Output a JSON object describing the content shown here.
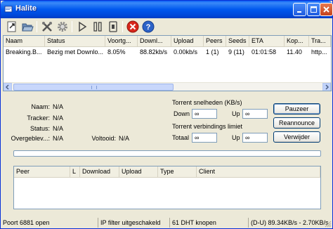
{
  "window": {
    "title": "Halite"
  },
  "toolbar": {
    "icons": [
      "open-torrent-icon",
      "open-folder-icon",
      "tools-icon",
      "settings-gear-icon",
      "resume-icon",
      "pause-icon",
      "stop-icon",
      "remove-icon",
      "help-icon"
    ]
  },
  "torrent_list": {
    "columns": [
      "Naam",
      "Status",
      "Voortg...",
      "Downl...",
      "Upload",
      "Peers",
      "Seeds",
      "ETA",
      "Kop...",
      "Tra..."
    ],
    "rows": [
      {
        "naam": "Breaking.B...",
        "status": "Bezig met Downlo...",
        "voortgang": "8.05%",
        "download": "88.82kb/s",
        "upload": "0.00kb/s",
        "peers": "1 (1)",
        "seeds": "9 (11)",
        "eta": "01:01:58",
        "kop": "11.40",
        "tra": "http..."
      }
    ]
  },
  "details": {
    "naam_label": "Naam:",
    "naam_value": "N/A",
    "tracker_label": "Tracker:",
    "tracker_value": "N/A",
    "status_label": "Status:",
    "status_value": "N/A",
    "overgeblev_label": "Overgeblev...:",
    "overgeblev_value": "N/A",
    "voltooid_label": "Voltooid:",
    "voltooid_value": "N/A",
    "speed_heading": "Torrent snelheden (KB/s)",
    "down_label": "Down",
    "down_value": "∞",
    "up_label": "Up",
    "up_value": "∞",
    "conn_heading": "Torrent verbindings limiet",
    "totaal_label": "Totaal",
    "totaal_value": "∞",
    "up2_label": "Up",
    "up2_value": "∞",
    "pause_button": "Pauzeer",
    "reannounce_button": "Reannounce",
    "remove_button": "Verwijder",
    "progress": 0
  },
  "peer_list": {
    "columns": [
      "Peer",
      "L",
      "Download",
      "Upload",
      "Type",
      "Client"
    ]
  },
  "statusbar": {
    "port": "Poort 6881 open",
    "ipfilter": "IP filter uitgeschakeld",
    "dht": "61 DHT knopen",
    "rates": "(D-U) 89.34KB/s - 2.70KB/s"
  },
  "colors": {
    "titlebar": "#0058EE",
    "window_bg": "#ECE9D8",
    "border": "#7F9DB9"
  }
}
